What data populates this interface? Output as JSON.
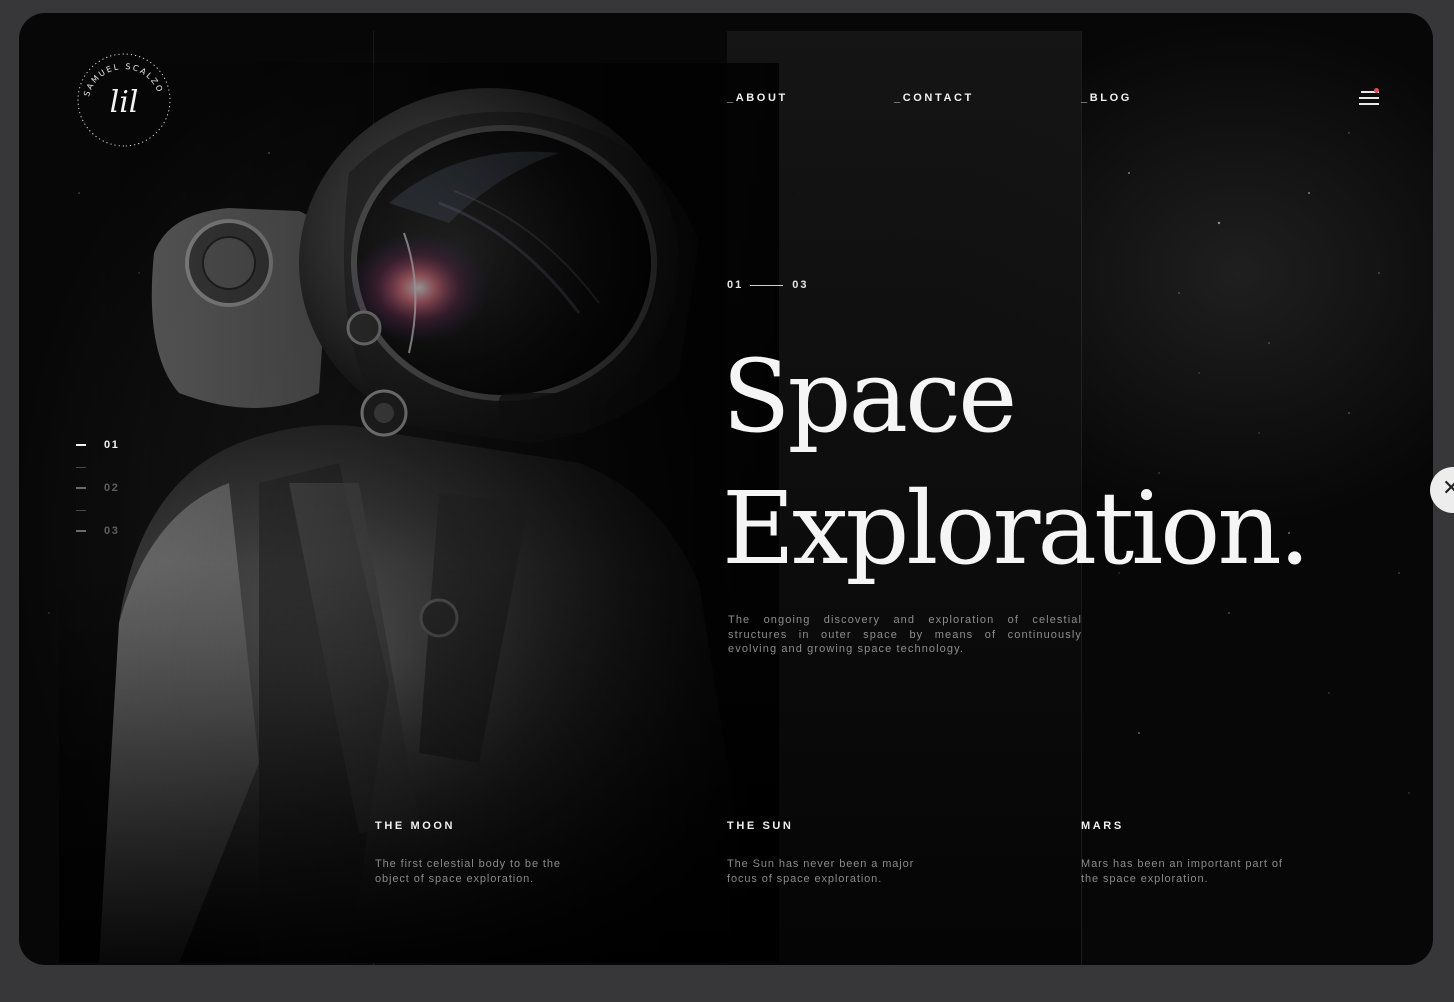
{
  "brand": {
    "name": "SAMUEL SCALZO",
    "monogram": "lil"
  },
  "nav": {
    "about": "_ABOUT",
    "contact": "_CONTACT",
    "blog": "_BLOG"
  },
  "slide": {
    "current": "01",
    "total": "03"
  },
  "hero": {
    "title_line1": "Space",
    "title_line2": "Exploration.",
    "intro": "The ongoing discovery and exploration of celestial structures in outer space by means of continuously evolving and growing space technology."
  },
  "pager": {
    "items": [
      {
        "label": "01",
        "active": true
      },
      {
        "label": "02",
        "active": false
      },
      {
        "label": "03",
        "active": false
      }
    ]
  },
  "planets": [
    {
      "title": "THE MOON",
      "text": "The first celestial body to be the object of space exploration."
    },
    {
      "title": "THE SUN",
      "text": "The Sun has never been a major focus of space exploration."
    },
    {
      "title": "MARS",
      "text": "Mars has been an important part of the space exploration."
    }
  ],
  "icons": {
    "menu": "hamburger-menu-icon",
    "next": "close-x-icon"
  },
  "colors": {
    "background": "#070707",
    "panel": "#141414",
    "text": "#f5f5f5",
    "muted": "#8a8a8a",
    "notification_dot": "#e54a5a"
  }
}
